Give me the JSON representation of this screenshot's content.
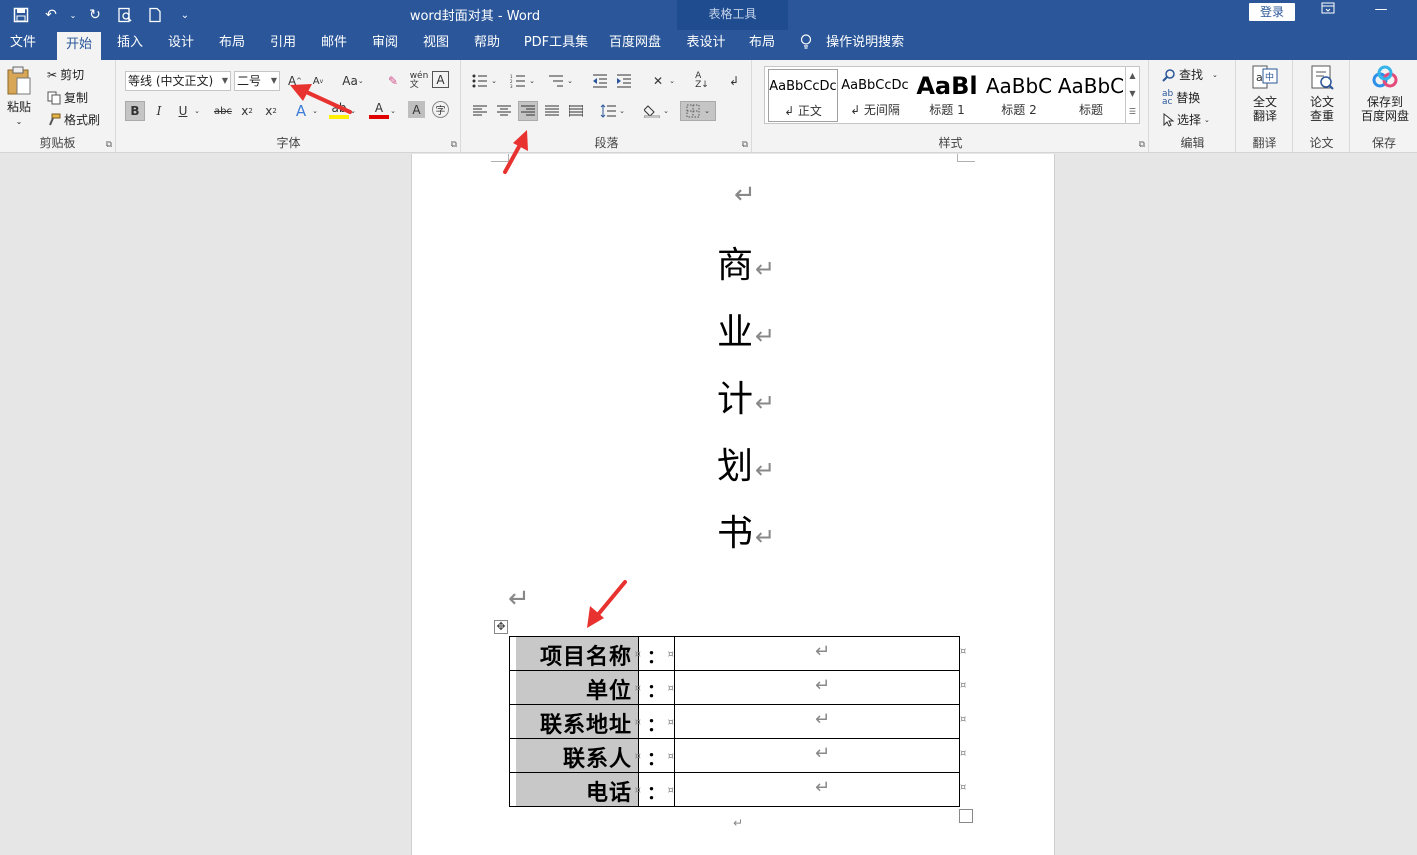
{
  "titlebar": {
    "doc_title": "word封面对其  -  Word",
    "context_tab_title": "表格工具",
    "login_label": "登录"
  },
  "tabs": [
    "文件",
    "开始",
    "插入",
    "设计",
    "布局",
    "引用",
    "邮件",
    "审阅",
    "视图",
    "帮助",
    "PDF工具集",
    "百度网盘",
    "表设计",
    "布局"
  ],
  "active_tab": "开始",
  "tell_me": "操作说明搜索",
  "ribbon": {
    "clipboard": {
      "paste": "粘贴",
      "cut": "剪切",
      "copy": "复制",
      "format_painter": "格式刷",
      "label": "剪贴板"
    },
    "font": {
      "font_name": "等线 (中文正文)",
      "font_size": "二号",
      "label": "字体"
    },
    "paragraph": {
      "label": "段落"
    },
    "styles": {
      "items": [
        {
          "sample": "AaBbCcDc",
          "name": "↲ 正文"
        },
        {
          "sample": "AaBbCcDc",
          "name": "↲ 无间隔"
        },
        {
          "sample": "AaBl",
          "name": "标题 1"
        },
        {
          "sample": "AaBbC",
          "name": "标题 2"
        },
        {
          "sample": "AaBbC",
          "name": "标题"
        }
      ],
      "label": "样式"
    },
    "editing": {
      "find": "查找",
      "replace": "替换",
      "select": "选择",
      "label": "编辑"
    },
    "translate": {
      "button": "全文\n翻译",
      "label": "翻译"
    },
    "paper": {
      "button": "论文\n查重",
      "label": "论文"
    },
    "save": {
      "button": "保存到\n百度网盘",
      "label": "保存"
    }
  },
  "document": {
    "title_chars": [
      "商",
      "业",
      "计",
      "划",
      "书"
    ],
    "paragraph_mark": "↵",
    "table_rows": [
      {
        "label": "项目名称",
        "colon": "："
      },
      {
        "label": "单位",
        "colon": "："
      },
      {
        "label": "联系地址",
        "colon": "："
      },
      {
        "label": "联系人",
        "colon": "："
      },
      {
        "label": "电话",
        "colon": "："
      }
    ]
  },
  "colors": {
    "title_bar": "#2b579a",
    "ribbon_bg": "#f3f3f3",
    "annotation_arrow": "#e8322f",
    "label_cell_shading": "#c8c8c8"
  }
}
